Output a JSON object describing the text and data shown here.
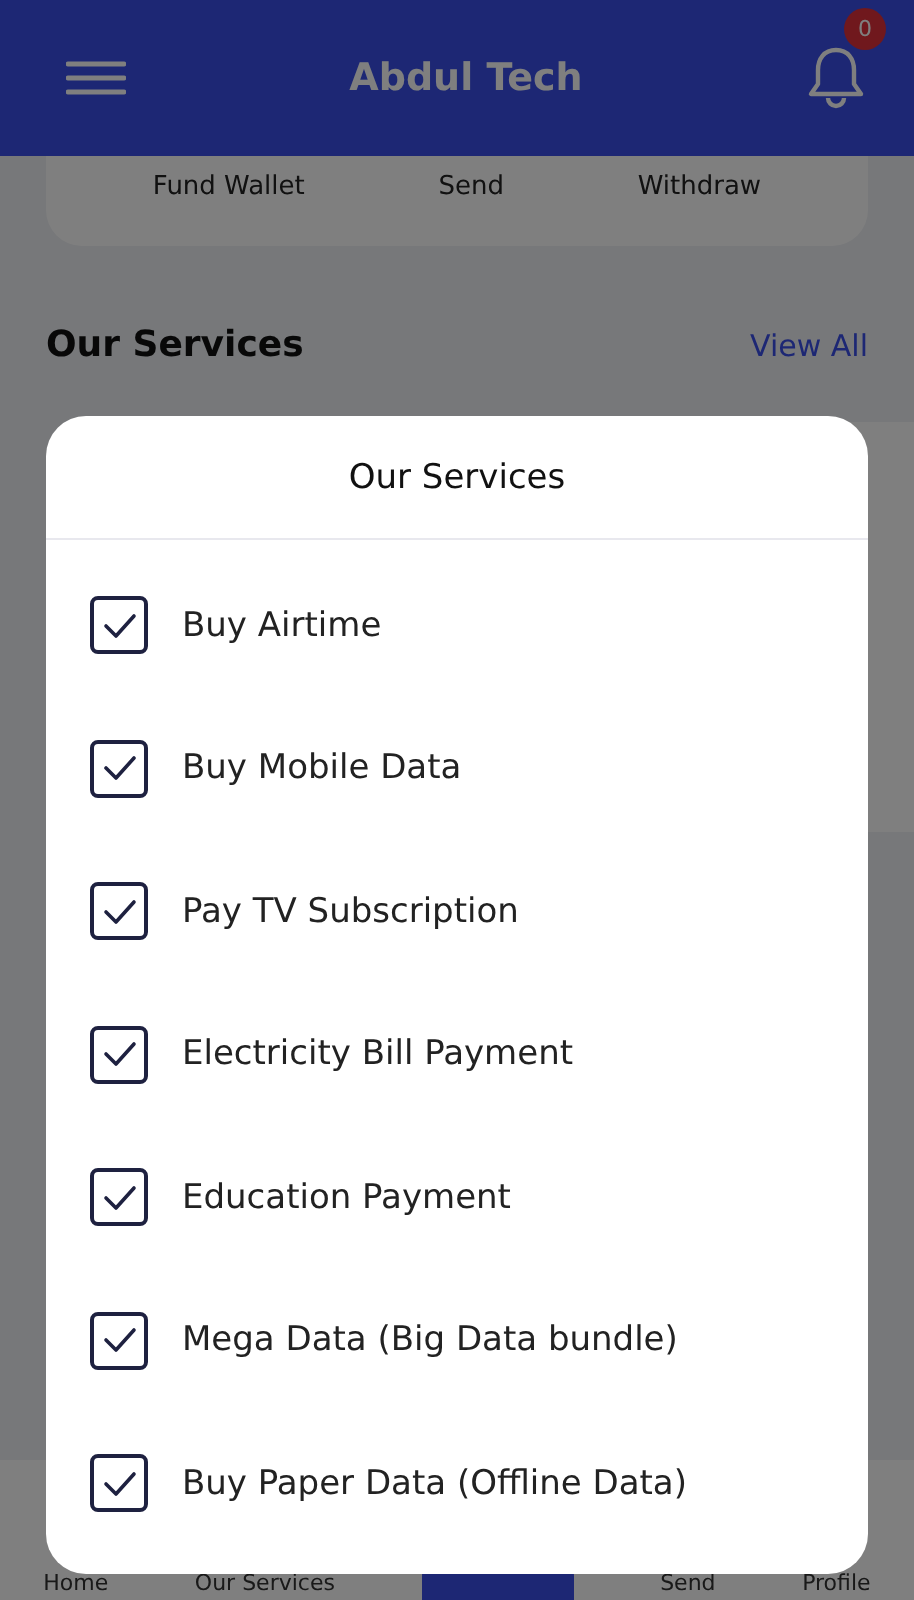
{
  "header": {
    "title": "Abdul Tech",
    "notification_count": "0"
  },
  "wallet_actions": [
    "Fund Wallet",
    "Send",
    "Withdraw"
  ],
  "section": {
    "title": "Our Services",
    "link": "View All"
  },
  "bottom_nav": [
    "Home",
    "Our Services",
    "Send",
    "Profile"
  ],
  "modal": {
    "title": "Our Services",
    "items": [
      {
        "label": "Buy Airtime",
        "checked": true
      },
      {
        "label": "Buy Mobile Data",
        "checked": true
      },
      {
        "label": "Pay TV Subscription",
        "checked": true
      },
      {
        "label": "Electricity Bill Payment",
        "checked": true
      },
      {
        "label": "Education Payment",
        "checked": true
      },
      {
        "label": "Mega Data (Big Data bundle)",
        "checked": true
      },
      {
        "label": "Buy Paper Data (Offline Data)",
        "checked": true
      }
    ]
  }
}
